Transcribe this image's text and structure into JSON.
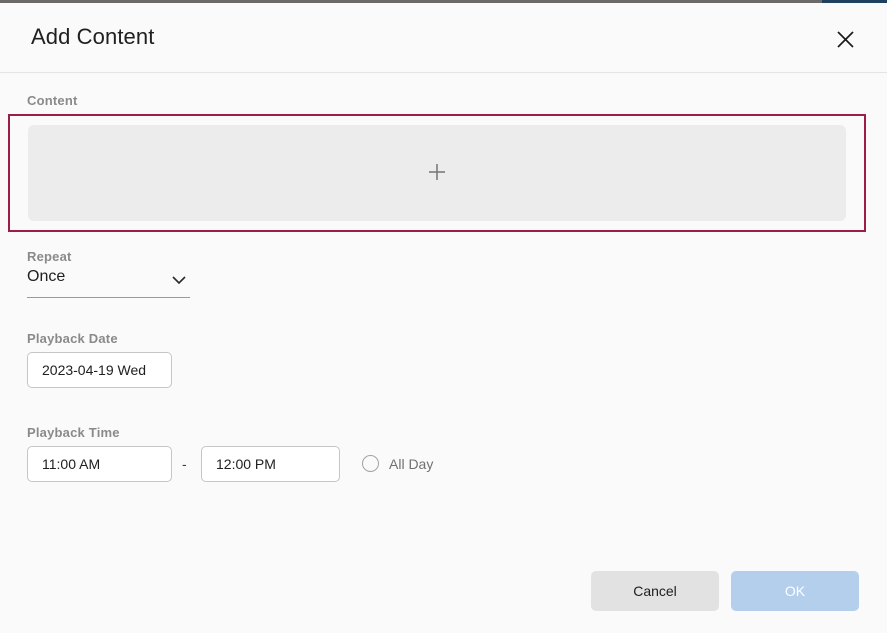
{
  "window": {
    "accent_color": "#20405f",
    "border_color": "#6b6a68"
  },
  "dialog": {
    "title": "Add Content",
    "close_icon": "close-icon"
  },
  "form": {
    "content": {
      "label": "Content",
      "add_icon": "plus-icon",
      "highlight_color": "#9c1d46",
      "placeholder_fill": "#ececec"
    },
    "repeat": {
      "label": "Repeat",
      "value": "Once",
      "chevron_icon": "chevron-down-icon",
      "options": [
        "Once"
      ]
    },
    "playback_date": {
      "label": "Playback Date",
      "value": "2023-04-19 Wed"
    },
    "playback_time": {
      "label": "Playback Time",
      "start_value": "11:00 AM",
      "separator": "-",
      "end_value": "12:00 PM",
      "all_day_label": "All Day",
      "all_day_checked": false
    }
  },
  "footer": {
    "cancel_label": "Cancel",
    "ok_label": "OK",
    "ok_color": "#b3cfec",
    "cancel_color": "#e2e2e2"
  }
}
